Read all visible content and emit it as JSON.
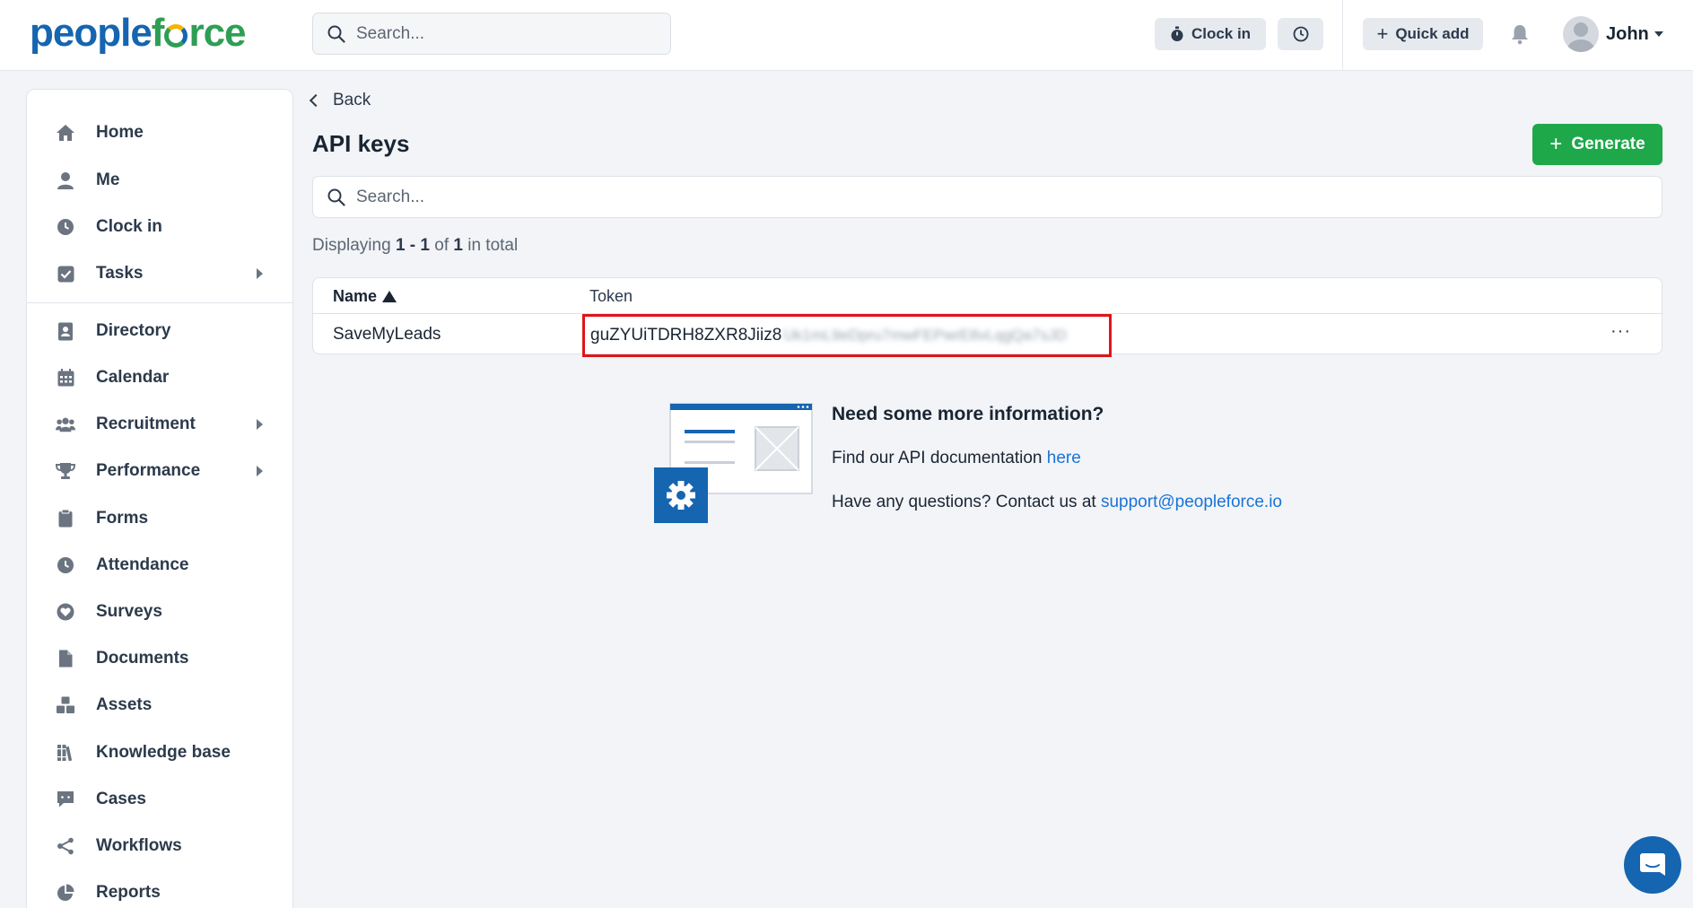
{
  "brand": {
    "logo_part1": "people",
    "logo_part2": "f",
    "logo_part3": "rce"
  },
  "topbar": {
    "search_placeholder": "Search...",
    "clock_in_label": "Clock in",
    "quick_add_label": "Quick add",
    "user_name": "John"
  },
  "sidebar": {
    "items": [
      {
        "label": "Home",
        "icon": "home-icon"
      },
      {
        "label": "Me",
        "icon": "user-icon"
      },
      {
        "label": "Clock in",
        "icon": "clock-icon"
      },
      {
        "label": "Tasks",
        "icon": "check-square-icon"
      },
      {
        "label": "Directory",
        "icon": "address-book-icon"
      },
      {
        "label": "Calendar",
        "icon": "calendar-icon"
      },
      {
        "label": "Recruitment",
        "icon": "users-icon"
      },
      {
        "label": "Performance",
        "icon": "trophy-icon"
      },
      {
        "label": "Forms",
        "icon": "clipboard-icon"
      },
      {
        "label": "Attendance",
        "icon": "clock-icon"
      },
      {
        "label": "Surveys",
        "icon": "heart-icon"
      },
      {
        "label": "Documents",
        "icon": "file-icon"
      },
      {
        "label": "Assets",
        "icon": "cubes-icon"
      },
      {
        "label": "Knowledge base",
        "icon": "books-icon"
      },
      {
        "label": "Cases",
        "icon": "chat-icon"
      },
      {
        "label": "Workflows",
        "icon": "share-icon"
      },
      {
        "label": "Reports",
        "icon": "pie-chart-icon"
      }
    ]
  },
  "main": {
    "back_label": "Back",
    "title": "API keys",
    "generate_label": "Generate",
    "search_placeholder": "Search...",
    "displaying": {
      "prefix": "Displaying ",
      "range": "1 - 1",
      "of": " of ",
      "total": "1",
      "suffix": " in total"
    },
    "table": {
      "columns": [
        "Name",
        "Token"
      ],
      "rows": [
        {
          "name": "SaveMyLeads",
          "token_visible": "guZYUiTDRH8ZXR8Jiiz8",
          "token_hidden": "Uk1mL9eDpru7mwFEPwrE8vLqgQa7sJD",
          "menu": "···"
        }
      ]
    },
    "info": {
      "title": "Need some more information?",
      "docs_text": "Find our API documentation ",
      "docs_link": "here",
      "contact_text": "Have any questions? Contact us at ",
      "contact_link": "support@peopleforce.io"
    }
  },
  "colors": {
    "primary": "#1565b0",
    "success": "#1ea84a",
    "highlight": "#e0141b",
    "link": "#1a73d8"
  }
}
